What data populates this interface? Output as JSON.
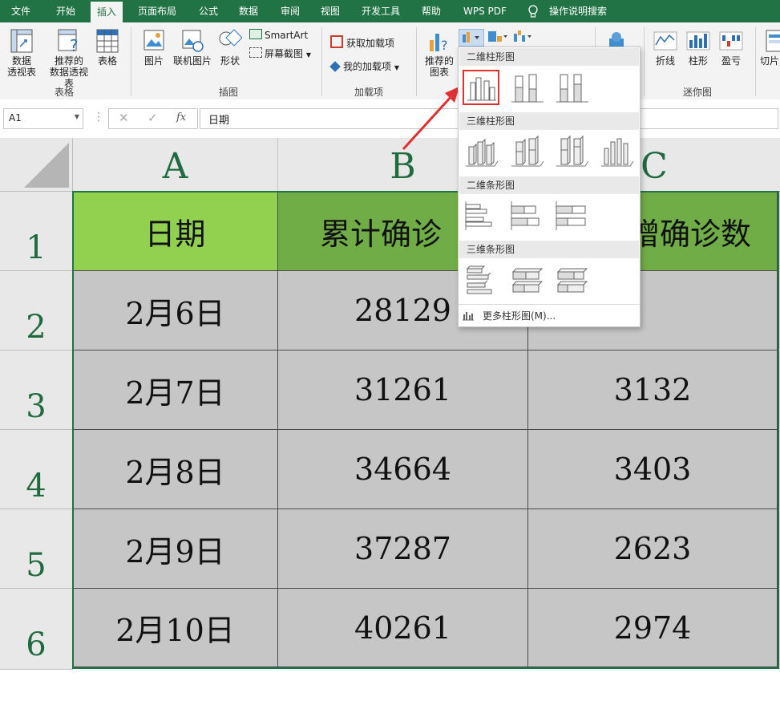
{
  "tabs": [
    "文件",
    "开始",
    "插入",
    "页面布局",
    "公式",
    "数据",
    "审阅",
    "视图",
    "开发工具",
    "帮助",
    "WPS PDF",
    "操作说明搜索"
  ],
  "active_tab": "插入",
  "ribbon": {
    "pivot": "数据\n透视表",
    "recommended_pivot": "推荐的\n数据透视表",
    "table": "表格",
    "group_tables": "表格",
    "picture": "图片",
    "online_picture": "联机图片",
    "shapes": "形状",
    "smartart": "SmartArt",
    "screenshot": "屏幕截图",
    "group_illustrations": "插图",
    "get_addins": "获取加载项",
    "my_addins": "我的加载项",
    "group_addins": "加载项",
    "recommended_charts": "推荐的\n图表",
    "spark_line": "折线",
    "spark_column": "柱形",
    "spark_winloss": "盈亏",
    "group_sparklines": "迷你图",
    "slicer": "切片"
  },
  "formula_bar": {
    "name_box": "A1",
    "fx": "fx",
    "content": "日期"
  },
  "columns": [
    "A",
    "B",
    "C"
  ],
  "rows": [
    "1",
    "2",
    "3",
    "4",
    "5",
    "6"
  ],
  "header_row": [
    "日期",
    "累计确诊",
    "增确诊数"
  ],
  "data_rows": [
    [
      "2月6日",
      "28129",
      ""
    ],
    [
      "2月7日",
      "31261",
      "3132"
    ],
    [
      "2月8日",
      "34664",
      "3403"
    ],
    [
      "2月9日",
      "37287",
      "2623"
    ],
    [
      "2月10日",
      "40261",
      "2974"
    ]
  ],
  "dropdown": {
    "sections": [
      "二维柱形图",
      "三维柱形图",
      "二维条形图",
      "三维条形图"
    ],
    "more": "更多柱形图(M)..."
  },
  "colors": {
    "excel_green": "#217346",
    "header_light": "#92d050",
    "header_dark": "#70ad47",
    "highlight_red": "#e03030"
  }
}
